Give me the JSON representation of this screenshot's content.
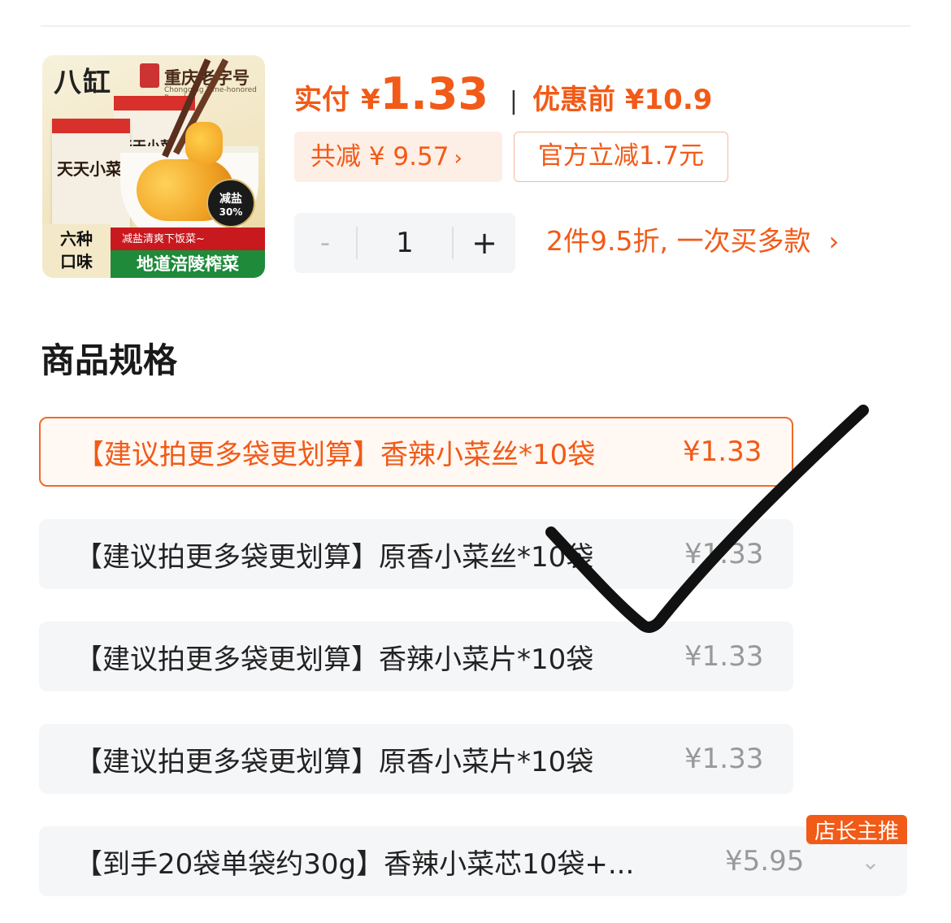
{
  "product": {
    "image": {
      "brand_text": "八缸",
      "sub_brand": "重庆老字号",
      "sub_brand_en": "Chongqing Time-honored Brand",
      "pack_title": "天天小菜",
      "badge_line1": "减盐",
      "badge_line2": "30%",
      "flavor_text": "六种\n口味",
      "tagline": "减盐清爽下饭菜~",
      "slogan": "地道涪陵榨菜"
    }
  },
  "price": {
    "label": "实付",
    "currency": "¥",
    "amount": "1.33",
    "separator": "|",
    "original_text": "优惠前 ¥10.9"
  },
  "discount": {
    "total_label": "共减 ¥ 9.57",
    "chevron": "›",
    "official_label": "官方立减1.7元"
  },
  "quantity": {
    "minus": "-",
    "value": "1",
    "plus": "+"
  },
  "promo": {
    "text": "2件9.5折, 一次买多款",
    "chevron": "›"
  },
  "spec": {
    "title": "商品规格",
    "options": [
      {
        "label": "【建议拍更多袋更划算】香辣小菜丝*10袋",
        "price": "¥1.33",
        "selected": true
      },
      {
        "label": "【建议拍更多袋更划算】原香小菜丝*10袋",
        "price": "¥1.33",
        "selected": false
      },
      {
        "label": "【建议拍更多袋更划算】香辣小菜片*10袋",
        "price": "¥1.33",
        "selected": false
      },
      {
        "label": "【建议拍更多袋更划算】原香小菜片*10袋",
        "price": "¥1.33",
        "selected": false
      },
      {
        "label": "【到手20袋单袋约30g】香辣小菜芯10袋+...",
        "price": "¥5.95",
        "selected": false,
        "badge": "店长主推",
        "expand_icon": "⌄"
      }
    ]
  },
  "colors": {
    "accent": "#f25a17",
    "selected_border": "#f06a2a",
    "option_bg": "#f5f6f8"
  }
}
